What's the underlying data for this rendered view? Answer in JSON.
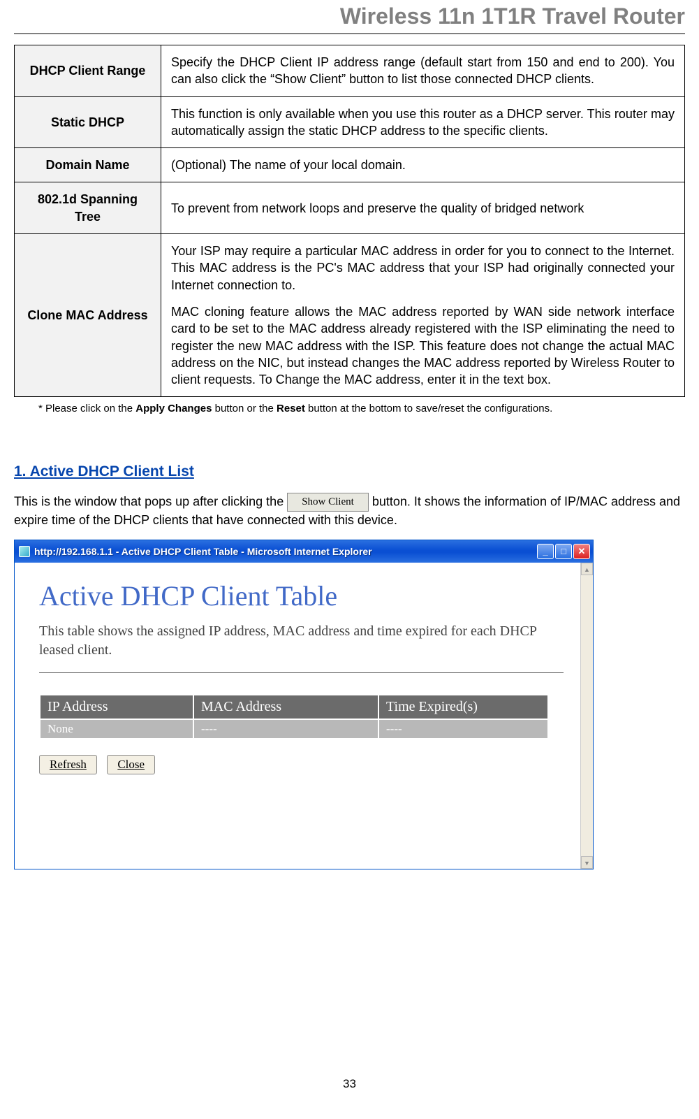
{
  "header": "Wireless 11n 1T1R Travel Router",
  "defTable": {
    "rows": [
      {
        "label": "DHCP Client Range",
        "desc": [
          "Specify the DHCP Client IP address range (default start from 150 and end to 200). You can also click the “Show Client” button to list those connected DHCP clients."
        ]
      },
      {
        "label": "Static DHCP",
        "desc": [
          "This function is only available when you use this router as a DHCP server. This router may automatically assign the static DHCP address to the specific clients."
        ]
      },
      {
        "label": "Domain Name",
        "desc": [
          "(Optional) The name of your local domain."
        ]
      },
      {
        "label": "802.1d Spanning Tree",
        "desc": [
          "To prevent from network loops and preserve the quality of bridged network"
        ]
      },
      {
        "label": "Clone MAC Address",
        "desc": [
          "Your ISP may require a particular MAC address in order for you to connect to the Internet. This MAC address is the PC's MAC address that your ISP had originally connected your Internet connection to.",
          "MAC cloning feature allows the MAC address reported by WAN side network interface card to be set to the MAC address already registered with the ISP eliminating the need to register the new MAC address with the ISP. This feature does not change the actual MAC address on the NIC, but instead changes the MAC address reported by Wireless Router to client requests. To Change the MAC address, enter it in the text box."
        ]
      }
    ]
  },
  "note": {
    "prefix": "* Please click on the ",
    "b1": "Apply Changes",
    "mid": " button or the ",
    "b2": "Reset",
    "suffix": " button at the bottom to save/reset the configurations."
  },
  "section1": {
    "heading": "1. Active DHCP Client List",
    "text1": "This is the window that pops up after clicking the ",
    "btn": "Show Client",
    "text2": " button. It shows the information of IP/MAC address and expire time of the DHCP clients that have connected with this device."
  },
  "ie": {
    "title": "http://192.168.1.1 - Active DHCP Client Table - Microsoft Internet Explorer",
    "pageTitle": "Active DHCP Client Table",
    "pageSub": "This table shows the assigned IP address, MAC address and time expired for each DHCP leased client.",
    "tableHeaders": [
      "IP Address",
      "MAC Address",
      "Time Expired(s)"
    ],
    "tableRow": [
      "None",
      "----",
      "----"
    ],
    "btnRefresh": "Refresh",
    "btnClose": "Close"
  },
  "pageNum": "33",
  "chart_data": {
    "type": "table",
    "title": "Active DHCP Client Table",
    "columns": [
      "IP Address",
      "MAC Address",
      "Time Expired(s)"
    ],
    "rows": [
      [
        "None",
        "----",
        "----"
      ]
    ]
  }
}
